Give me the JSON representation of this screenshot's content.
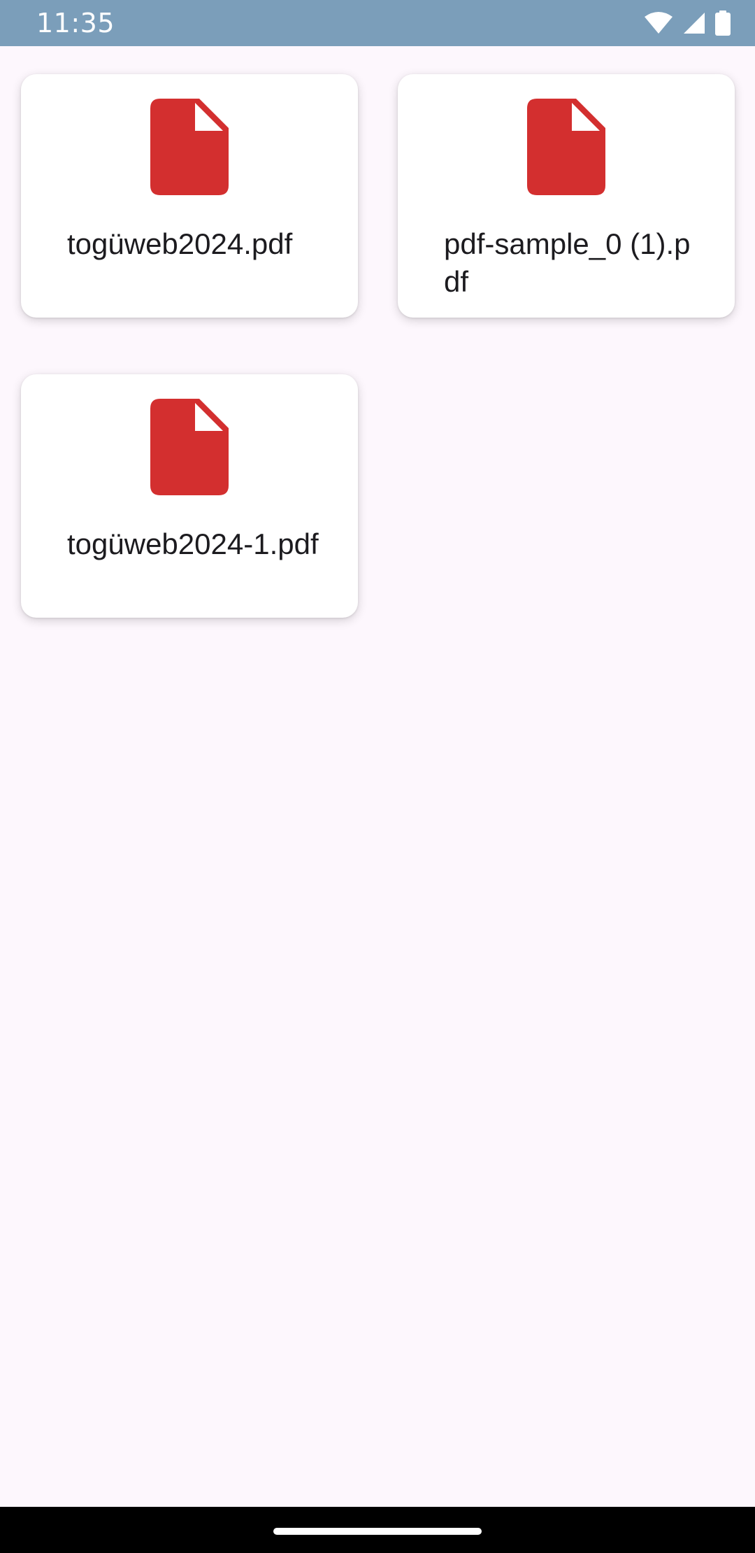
{
  "status_bar": {
    "time": "11:35",
    "icons": [
      "wifi-icon",
      "cellular-signal-icon",
      "battery-icon"
    ],
    "background_color": "#7b9eba"
  },
  "files": [
    {
      "name": "togüweb2024.pdf",
      "icon": "pdf-file-icon"
    },
    {
      "name": "pdf-sample_0 (1).pdf",
      "icon": "pdf-file-icon"
    },
    {
      "name": "togüweb2024-1.pdf",
      "icon": "pdf-file-icon"
    }
  ],
  "colors": {
    "pdf_icon": "#d32f2f",
    "page_background": "#fdf7fd",
    "card_background": "#ffffff",
    "text": "#1c1b1f"
  }
}
